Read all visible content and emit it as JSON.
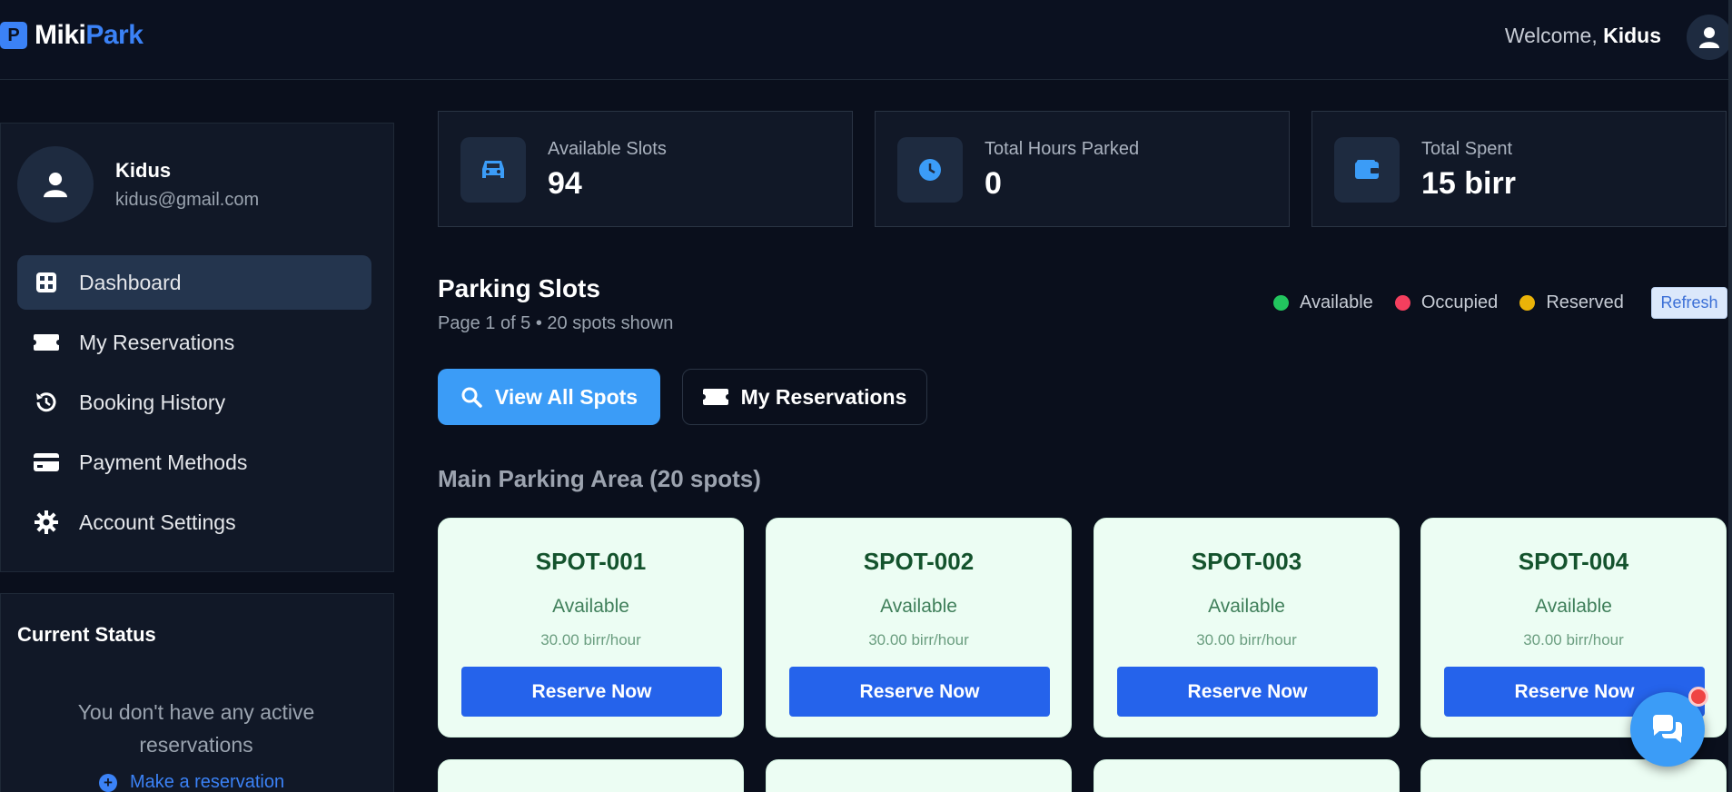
{
  "brand": {
    "logo_letter": "P",
    "name_part1": "Miki",
    "name_part2": "Park",
    "accent": "#3b82f6"
  },
  "header": {
    "welcome_prefix": "Welcome,",
    "user_name": "Kidus"
  },
  "sidebar": {
    "profile": {
      "name": "Kidus",
      "email": "kidus@gmail.com"
    },
    "nav": [
      {
        "label": "Dashboard",
        "icon": "grid-icon",
        "active": true
      },
      {
        "label": "My Reservations",
        "icon": "ticket-icon"
      },
      {
        "label": "Booking History",
        "icon": "history-icon"
      },
      {
        "label": "Payment Methods",
        "icon": "credit-card-icon"
      },
      {
        "label": "Account Settings",
        "icon": "gear-icon"
      }
    ],
    "status": {
      "title": "Current Status",
      "message": "You don't have any active reservations",
      "link": "Make a reservation"
    }
  },
  "stats": [
    {
      "label": "Available Slots",
      "value": "94",
      "icon": "car-icon"
    },
    {
      "label": "Total Hours Parked",
      "value": "0",
      "icon": "clock-icon"
    },
    {
      "label": "Total Spent",
      "value": "15 birr",
      "icon": "wallet-icon"
    }
  ],
  "parking": {
    "title": "Parking Slots",
    "subtitle": "Page 1 of 5 • 20 spots shown",
    "legend": [
      {
        "label": "Available",
        "color": "#22c55e"
      },
      {
        "label": "Occupied",
        "color": "#f43f5e"
      },
      {
        "label": "Reserved",
        "color": "#eab308"
      }
    ],
    "refresh_label": "Refresh",
    "view_all_label": "View All Spots",
    "my_reservations_label": "My Reservations",
    "area_title": "Main Parking Area (20 spots)",
    "spots": [
      {
        "name": "SPOT-001",
        "status": "Available",
        "rate": "30.00 birr/hour",
        "button": "Reserve Now"
      },
      {
        "name": "SPOT-002",
        "status": "Available",
        "rate": "30.00 birr/hour",
        "button": "Reserve Now"
      },
      {
        "name": "SPOT-003",
        "status": "Available",
        "rate": "30.00 birr/hour",
        "button": "Reserve Now"
      },
      {
        "name": "SPOT-004",
        "status": "Available",
        "rate": "30.00 birr/hour",
        "button": "Reserve Now"
      }
    ]
  }
}
